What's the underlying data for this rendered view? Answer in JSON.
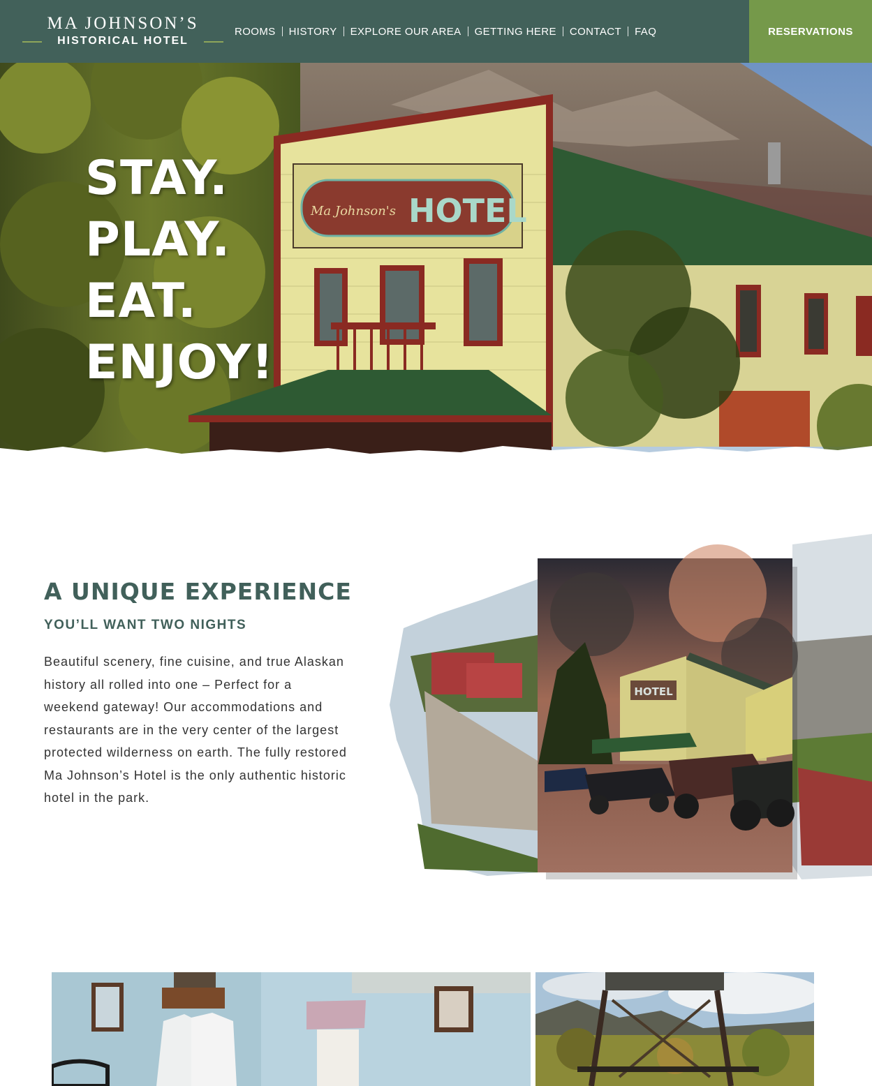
{
  "header": {
    "logo_top": "MA JOHNSON’S",
    "logo_bottom": "HISTORICAL HOTEL",
    "nav": [
      {
        "label": "ROOMS"
      },
      {
        "label": "HISTORY"
      },
      {
        "label": "EXPLORE OUR AREA"
      },
      {
        "label": "GETTING HERE"
      },
      {
        "label": "CONTACT"
      },
      {
        "label": "FAQ"
      }
    ],
    "reservations_label": "RESERVATIONS"
  },
  "hero": {
    "lines": [
      "STAY.",
      "PLAY.",
      "EAT.",
      "ENJOY!"
    ],
    "sign_script": "Ma Johnson's",
    "sign_text": "HOTEL"
  },
  "experience": {
    "title": "A UNIQUE EXPERIENCE",
    "subtitle": "YOU’LL WANT TWO NIGHTS",
    "body": "Beautiful scenery, fine cuisine, and true Alaskan history all rolled into one – Perfect for a weekend gateway! Our accommodations and restaurants are in the very center of the largest protected wilderness on earth. The fully restored Ma Johnson’s Hotel is the only authentic historic hotel in the park.",
    "photo_sign": "HOTEL"
  },
  "colors": {
    "header_bg": "#42615a",
    "reservations_bg": "#75994a",
    "heading": "#41605a",
    "logo_accent": "#8ea65a"
  }
}
